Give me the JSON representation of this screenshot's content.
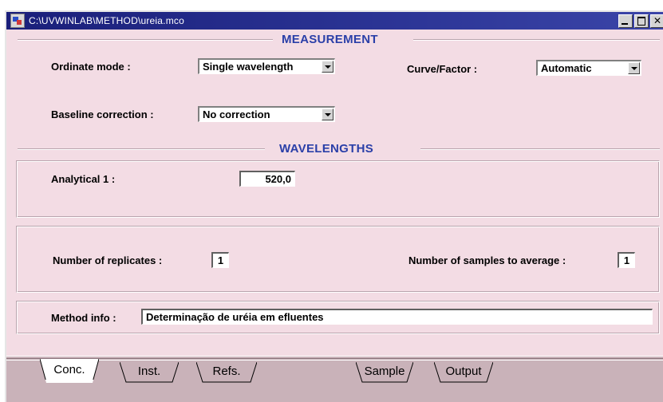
{
  "window": {
    "title": "C:\\UVWINLAB\\METHOD\\ureia.mco"
  },
  "sections": {
    "measurement": "MEASUREMENT",
    "wavelengths": "WAVELENGTHS"
  },
  "measurement": {
    "ordinate_mode_label": "Ordinate mode :",
    "ordinate_mode_value": "Single wavelength",
    "curve_factor_label": "Curve/Factor :",
    "curve_factor_value": "Automatic",
    "baseline_label": "Baseline correction :",
    "baseline_value": "No correction"
  },
  "wavelengths": {
    "analytical_label": "Analytical 1 :",
    "analytical_value": "520,0"
  },
  "replicates": {
    "replicates_label": "Number of replicates :",
    "replicates_value": "1",
    "samples_label": "Number of samples to average :",
    "samples_value": "1"
  },
  "method_info": {
    "label": "Method info :",
    "value": "Determinação de uréia em efluentes"
  },
  "tabs": [
    {
      "label": "Conc."
    },
    {
      "label": "Inst."
    },
    {
      "label": "Refs."
    },
    {
      "label": "Sample"
    },
    {
      "label": "Output"
    }
  ],
  "colors": {
    "titlebar": "#1a1f7a",
    "panel_bg": "#f3dce4",
    "section_header": "#2a3fa8",
    "tab_strip": "#c9b2b9"
  },
  "icons": {
    "app": "app-icon",
    "minimize": "minimize-icon",
    "maximize": "maximize-icon",
    "close": "close-icon"
  }
}
